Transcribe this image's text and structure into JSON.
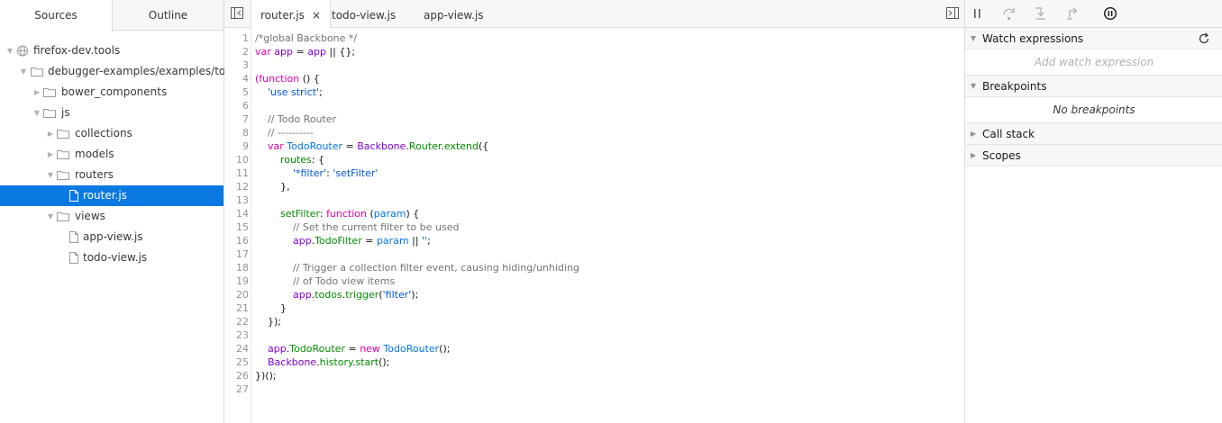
{
  "left_tabs": {
    "sources": "Sources",
    "outline": "Outline"
  },
  "tree": [
    {
      "label": "firefox-dev.tools",
      "type": "domain",
      "depth": 0,
      "expanded": true
    },
    {
      "label": "debugger-examples/examples/todomvc",
      "type": "folder",
      "depth": 1,
      "expanded": true
    },
    {
      "label": "bower_components",
      "type": "folder",
      "depth": 2,
      "expanded": false
    },
    {
      "label": "js",
      "type": "folder",
      "depth": 2,
      "expanded": true
    },
    {
      "label": "collections",
      "type": "folder",
      "depth": 3,
      "expanded": false
    },
    {
      "label": "models",
      "type": "folder",
      "depth": 3,
      "expanded": false
    },
    {
      "label": "routers",
      "type": "folder",
      "depth": 3,
      "expanded": true
    },
    {
      "label": "router.js",
      "type": "file",
      "depth": 4,
      "selected": true
    },
    {
      "label": "views",
      "type": "folder",
      "depth": 3,
      "expanded": true
    },
    {
      "label": "app-view.js",
      "type": "file",
      "depth": 4
    },
    {
      "label": "todo-view.js",
      "type": "file",
      "depth": 4
    }
  ],
  "editor_tabs": [
    {
      "label": "router.js",
      "active": true,
      "close": "×"
    },
    {
      "label": "todo-view.js",
      "active": false
    },
    {
      "label": "app-view.js",
      "active": false
    }
  ],
  "code_lines": [
    [
      [
        "/*global Backbone */",
        "cm"
      ]
    ],
    [
      [
        "var ",
        "kw"
      ],
      [
        "app",
        "va"
      ],
      [
        " = ",
        "pl"
      ],
      [
        "app",
        "va"
      ],
      [
        " || {};",
        "pl"
      ]
    ],
    [],
    [
      [
        "(function",
        "kw"
      ],
      [
        " () {",
        "pl"
      ]
    ],
    [
      [
        "    ",
        "pl"
      ],
      [
        "'use strict'",
        "st"
      ],
      [
        ";",
        "pl"
      ]
    ],
    [],
    [
      [
        "    ",
        "pl"
      ],
      [
        "// Todo Router",
        "cm"
      ]
    ],
    [
      [
        "    ",
        "pl"
      ],
      [
        "// ----------",
        "cm"
      ]
    ],
    [
      [
        "    ",
        "pl"
      ],
      [
        "var ",
        "kw"
      ],
      [
        "TodoRouter",
        "de"
      ],
      [
        " = ",
        "pl"
      ],
      [
        "Backbone",
        "va"
      ],
      [
        ".",
        "pl"
      ],
      [
        "Router",
        "pr"
      ],
      [
        ".",
        "pl"
      ],
      [
        "extend",
        "pr"
      ],
      [
        "({",
        "pl"
      ]
    ],
    [
      [
        "        ",
        "pl"
      ],
      [
        "routes",
        "pr"
      ],
      [
        ": {",
        "pl"
      ]
    ],
    [
      [
        "            ",
        "pl"
      ],
      [
        "'*filter'",
        "st"
      ],
      [
        ": ",
        "pl"
      ],
      [
        "'setFilter'",
        "st"
      ]
    ],
    [
      [
        "        ",
        "pl"
      ],
      [
        "},",
        "pl"
      ]
    ],
    [],
    [
      [
        "        ",
        "pl"
      ],
      [
        "setFilter",
        "pr"
      ],
      [
        ": ",
        "pl"
      ],
      [
        "function",
        "kw"
      ],
      [
        " (",
        "pl"
      ],
      [
        "param",
        "de"
      ],
      [
        ") {",
        "pl"
      ]
    ],
    [
      [
        "            ",
        "pl"
      ],
      [
        "// Set the current filter to be used",
        "cm"
      ]
    ],
    [
      [
        "            ",
        "pl"
      ],
      [
        "app",
        "va"
      ],
      [
        ".",
        "pl"
      ],
      [
        "TodoFilter",
        "pr"
      ],
      [
        " = ",
        "pl"
      ],
      [
        "param",
        "de"
      ],
      [
        " || ",
        "pl"
      ],
      [
        "''",
        "st"
      ],
      [
        ";",
        "pl"
      ]
    ],
    [],
    [
      [
        "            ",
        "pl"
      ],
      [
        "// Trigger a collection filter event, causing hiding/unhiding",
        "cm"
      ]
    ],
    [
      [
        "            ",
        "pl"
      ],
      [
        "// of Todo view items",
        "cm"
      ]
    ],
    [
      [
        "            ",
        "pl"
      ],
      [
        "app",
        "va"
      ],
      [
        ".",
        "pl"
      ],
      [
        "todos",
        "pr"
      ],
      [
        ".",
        "pl"
      ],
      [
        "trigger",
        "pr"
      ],
      [
        "(",
        "pl"
      ],
      [
        "'filter'",
        "st"
      ],
      [
        ");",
        "pl"
      ]
    ],
    [
      [
        "        ",
        "pl"
      ],
      [
        "}",
        "pl"
      ]
    ],
    [
      [
        "    ",
        "pl"
      ],
      [
        "});",
        "pl"
      ]
    ],
    [],
    [
      [
        "    ",
        "pl"
      ],
      [
        "app",
        "va"
      ],
      [
        ".",
        "pl"
      ],
      [
        "TodoRouter",
        "pr"
      ],
      [
        " = ",
        "pl"
      ],
      [
        "new ",
        "kw"
      ],
      [
        "TodoRouter",
        "de"
      ],
      [
        "();",
        "pl"
      ]
    ],
    [
      [
        "    ",
        "pl"
      ],
      [
        "Backbone",
        "va"
      ],
      [
        ".",
        "pl"
      ],
      [
        "history",
        "pr"
      ],
      [
        ".",
        "pl"
      ],
      [
        "start",
        "pr"
      ],
      [
        "();",
        "pl"
      ]
    ],
    [
      [
        "})();",
        "pl"
      ]
    ],
    []
  ],
  "syntax_colors": {
    "cm": "#737373",
    "kw": "#dd00a9",
    "va": "#8000d7",
    "st": "#0055d8",
    "pr": "#058b00",
    "de": "#0074e8",
    "pl": "#18191a"
  },
  "right": {
    "watch": {
      "title": "Watch expressions",
      "placeholder": "Add watch expression"
    },
    "breakpoints": {
      "title": "Breakpoints",
      "empty": "No breakpoints"
    },
    "callstack": {
      "title": "Call stack"
    },
    "scopes": {
      "title": "Scopes"
    }
  },
  "icons": {
    "pause": "pause-icon",
    "step_over": "step-over-icon",
    "step_in": "step-in-icon",
    "step_out": "step-out-icon",
    "pause_on_exceptions": "pause-on-exceptions-icon",
    "refresh": "refresh-icon"
  }
}
